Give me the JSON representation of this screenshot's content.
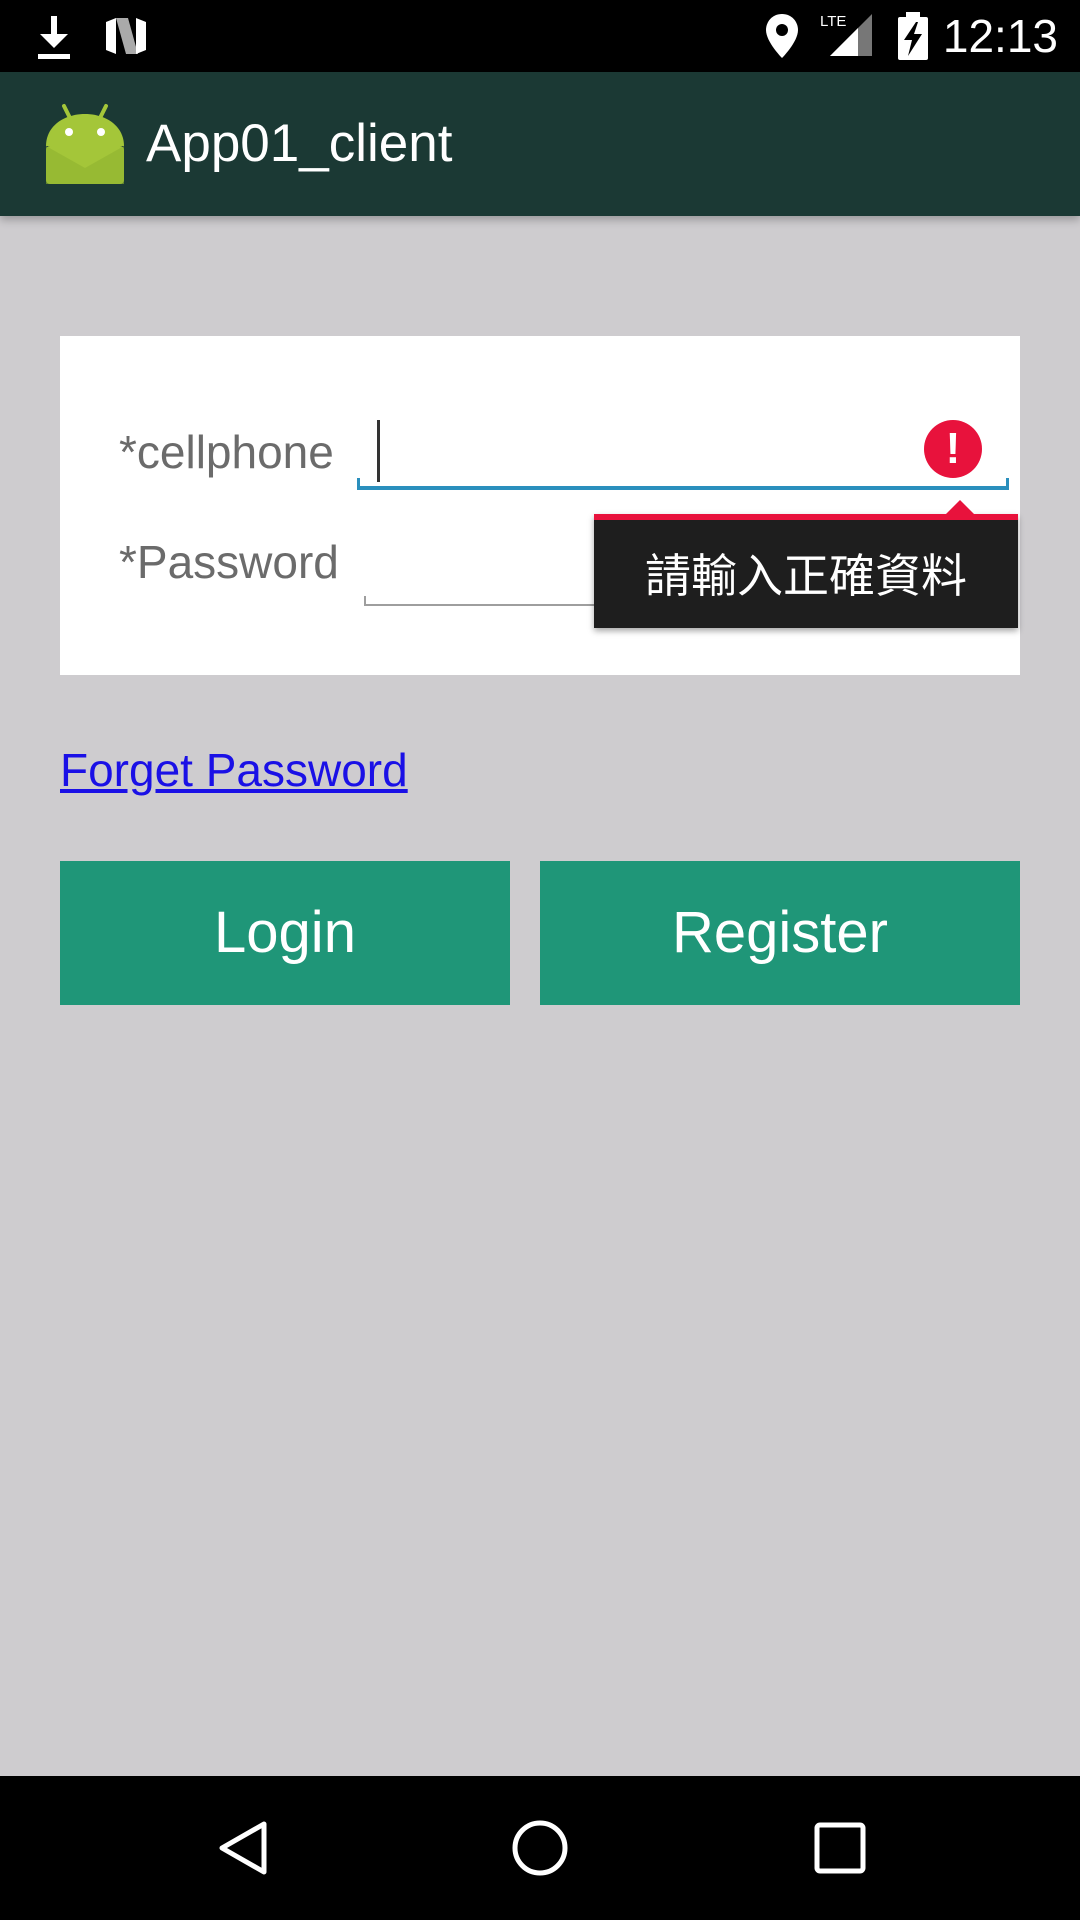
{
  "status_bar": {
    "time": "12:13",
    "network_label": "LTE",
    "icons": [
      "download-icon",
      "n-logo-icon",
      "location-icon",
      "lte-signal-icon",
      "battery-charging-icon"
    ]
  },
  "app_bar": {
    "title": "App01_client",
    "logo_icon": "android-logo-icon"
  },
  "form": {
    "cellphone": {
      "label": "*cellphone",
      "value": "",
      "error_icon": "error-exclamation-icon",
      "error_message": "請輸入正確資料"
    },
    "password": {
      "label": "*Password",
      "value": ""
    }
  },
  "links": {
    "forget_password": "Forget Password"
  },
  "buttons": {
    "login": "Login",
    "register": "Register"
  },
  "nav_bar": {
    "icons": [
      "back-icon",
      "home-icon",
      "recents-icon"
    ]
  },
  "colors": {
    "app_bar": "#1b3934",
    "background": "#cecccf",
    "button": "#1f9678",
    "link": "#1a10e6",
    "error": "#e8123c",
    "field_focus": "#2a8fbd"
  }
}
